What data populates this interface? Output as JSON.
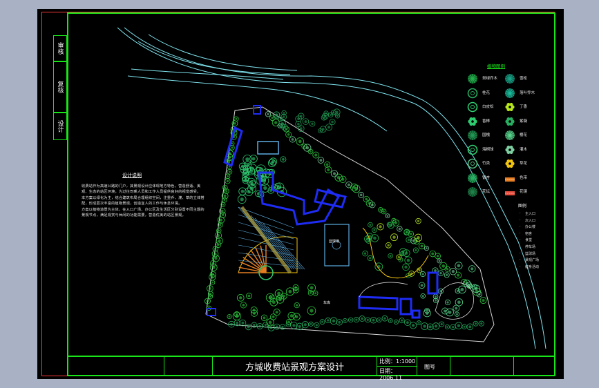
{
  "drawing": {
    "side_labels": [
      "审核",
      "复核",
      "设计"
    ],
    "title": "方城收费站景观方案设计",
    "scale_label": "比例：",
    "scale_value": "1:1000",
    "date_label": "日期：",
    "date_value": "2006.11",
    "sheet_label": "图号"
  },
  "design_notes": {
    "title": "设计说明",
    "paragraphs": [
      "收费站作为高速公路的门户，其景观设计应体现地方特色，营造舒适、美观、生态的站区环境，为过往司乘人员和工作人员提供良好的视觉感受。",
      "本方案以绿化为主，结合建筑布局合理组织空间，注重乔、灌、草的立体搭配，形成层次丰富的植物景观，创造宜人的工作与休息环境。",
      "方案以植物造景为主体，在入口广场、办公区及生活区分别设置不同主题的景观节点，满足观赏与休闲的功能需要，营造优美的站区景观。"
    ]
  },
  "legend": {
    "title": "植物图例",
    "items": [
      {
        "label": "常绿乔木",
        "color": "#22b14c",
        "shape": "star"
      },
      {
        "label": "雪松",
        "color": "#17a589",
        "shape": "star"
      },
      {
        "label": "桂花",
        "color": "#27ae60",
        "shape": "ring"
      },
      {
        "label": "落叶乔木",
        "color": "#1abc9c",
        "shape": "star"
      },
      {
        "label": "白皮松",
        "color": "#2ecc71",
        "shape": "ring"
      },
      {
        "label": "丁香",
        "color": "#b5e61d",
        "shape": "flower"
      },
      {
        "label": "香樟",
        "color": "#2ecc71",
        "shape": "flower"
      },
      {
        "label": "紫薇",
        "color": "#27ae60",
        "shape": "flower"
      },
      {
        "label": "国槐",
        "color": "#229954",
        "shape": "star"
      },
      {
        "label": "樱花",
        "color": "#58d68d",
        "shape": "star"
      },
      {
        "label": "海桐球",
        "color": "#2ecc71",
        "shape": "ring"
      },
      {
        "label": "灌木",
        "color": "#7dcea0",
        "shape": "flower"
      },
      {
        "label": "竹类",
        "color": "#52be80",
        "shape": "ring"
      },
      {
        "label": "草花",
        "color": "#f1c40f",
        "shape": "flower"
      },
      {
        "label": "银杏",
        "color": "#28b463",
        "shape": "star"
      },
      {
        "label": "色带",
        "color": "#e67e22",
        "shape": "band"
      },
      {
        "label": "花坛",
        "color": "#1e8449",
        "shape": "star"
      },
      {
        "label": "花镜",
        "color": "#e74c3c",
        "shape": "band"
      }
    ]
  },
  "site_legend": {
    "title": "图例",
    "items": [
      "主入口",
      "次入口",
      "办公楼",
      "宿舍",
      "食堂",
      "停车场",
      "篮球场",
      "景观广场",
      "健身活动"
    ]
  },
  "plan_labels": {
    "court": "篮球场",
    "parking": "车库"
  },
  "colors": {
    "frame_green": "#19e619",
    "frame_red": "#ff3b3b",
    "road_cyan": "#7fe5f0",
    "building_blue": "#1e2cf5",
    "tree_green": "#2ecc40"
  }
}
